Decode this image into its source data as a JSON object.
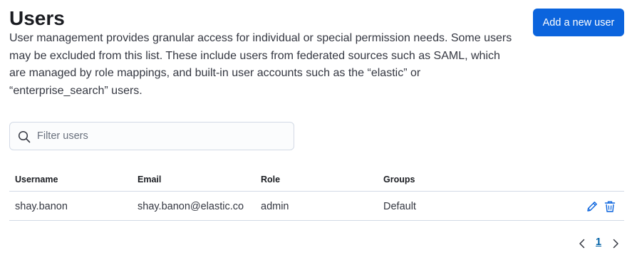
{
  "page": {
    "title": "Users",
    "description": "User management provides granular access for individual or special permission needs. Some users may be excluded from this list. These include users from federated sources such as SAML, which are managed by role mappings, and built-in user accounts such as the “elastic” or “enterprise_search” users.",
    "add_button_label": "Add a new user"
  },
  "search": {
    "placeholder": "Filter users",
    "value": ""
  },
  "table": {
    "columns": [
      "Username",
      "Email",
      "Role",
      "Groups"
    ],
    "rows": [
      {
        "username": "shay.banon",
        "email": "shay.banon@elastic.co",
        "role": "admin",
        "groups": "Default"
      }
    ]
  },
  "pagination": {
    "current_page": "1"
  },
  "colors": {
    "primary": "#0b64dd",
    "link": "#0061a6",
    "border": "#d3dae6"
  },
  "icons": {
    "search": "search-icon",
    "edit": "pencil-icon",
    "delete": "trash-icon",
    "prev": "chevron-left-icon",
    "next": "chevron-right-icon"
  }
}
